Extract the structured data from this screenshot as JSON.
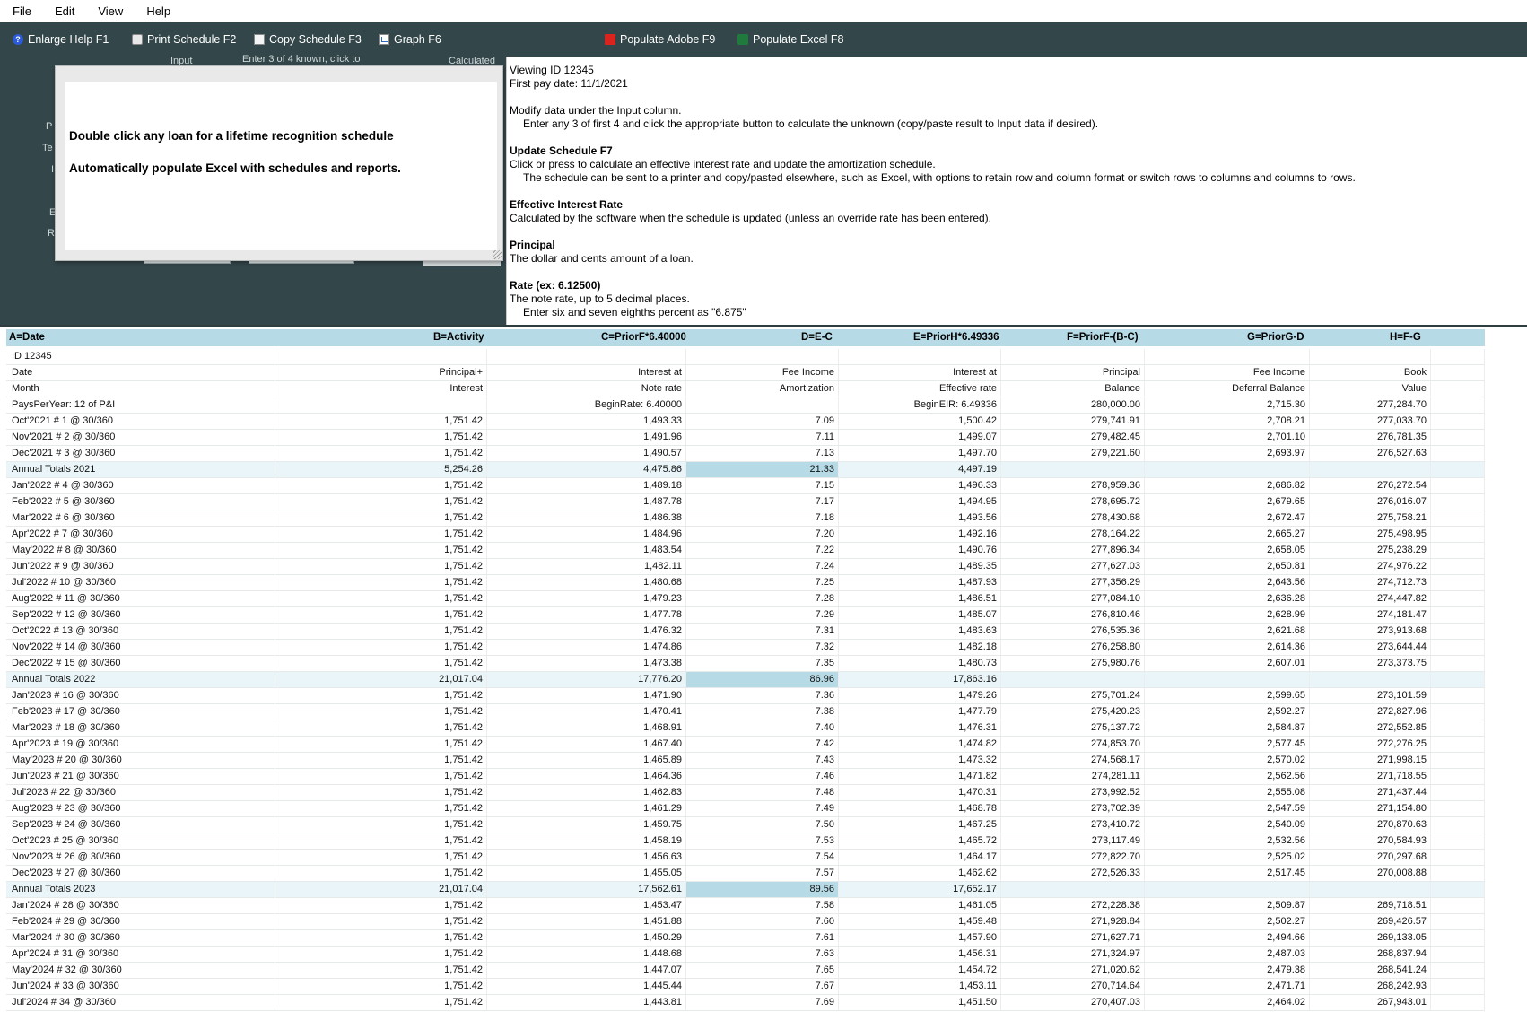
{
  "menu": [
    "File",
    "Edit",
    "View",
    "Help"
  ],
  "toolbar": {
    "enlarge_help": "Enlarge Help  F1",
    "print_schedule": "Print Schedule  F2",
    "copy_schedule": "Copy Schedule  F3",
    "graph": "Graph  F6",
    "populate_adobe": "Populate Adobe  F9",
    "populate_excel": "Populate Excel  F8"
  },
  "left_panel": {
    "ghost_top": [
      "Input",
      "Enter 3 of 4 known, click to",
      "Calculated"
    ],
    "ghost_labels": [
      "P",
      "Te",
      "I",
      "E",
      "R"
    ]
  },
  "popup": {
    "line1": "Double click any loan for a lifetime recognition schedule",
    "line2": "Automatically populate Excel with schedules and reports."
  },
  "help": {
    "viewing": "Viewing ID 12345",
    "first_pay": "First pay date: 11/1/2021",
    "modify": "Modify data under the Input column.",
    "modify_sub": "Enter any 3 of first 4 and click the appropriate button to calculate the unknown (copy/paste result to Input data if desired).",
    "update_title": "Update Schedule  F7",
    "update_body": "Click or press to calculate an effective interest rate and update the amortization schedule.",
    "update_sub": "The schedule can be sent to a printer and copy/pasted elsewhere, such as Excel, with options to retain row and column format or switch rows to columns and columns to rows.",
    "eir_title": "Effective Interest Rate",
    "eir_body": "Calculated by the software when the schedule is updated (unless an override rate has been entered).",
    "principal_title": "Principal",
    "principal_body": "The dollar and cents amount of a loan.",
    "rate_title": "Rate (ex: 6.12500)",
    "rate_body": "The note rate, up to 5 decimal places.",
    "rate_sub": "Enter six and seven eighths percent as \"6.875\""
  },
  "grid": {
    "columns": [
      "A=Date",
      "B=Activity",
      "C=PriorF*6.40000",
      "D=E-C",
      "E=PriorH*6.49336",
      "F=PriorF-(B-C)",
      "G=PriorG-D",
      "H=F-G"
    ],
    "rows": [
      {
        "c": [
          "ID 12345",
          "",
          "",
          "",
          "",
          "",
          "",
          ""
        ]
      },
      {
        "c": [
          "Date",
          "Principal+",
          "Interest at",
          "Fee Income",
          "Interest at",
          "Principal",
          "Fee Income",
          "Book"
        ]
      },
      {
        "c": [
          "Month",
          "Interest",
          "Note rate",
          "Amortization",
          "Effective rate",
          "Balance",
          "Deferral Balance",
          "Value"
        ]
      },
      {
        "c": [
          "PaysPerYear: 12 of P&I",
          "",
          "BeginRate: 6.40000",
          "",
          "BeginEIR: 6.49336",
          "280,000.00",
          "2,715.30",
          "277,284.70"
        ]
      },
      {
        "c": [
          "Oct'2021  # 1 @ 30/360",
          "1,751.42",
          "1,493.33",
          "7.09",
          "1,500.42",
          "279,741.91",
          "2,708.21",
          "277,033.70"
        ]
      },
      {
        "c": [
          "Nov'2021  # 2 @ 30/360",
          "1,751.42",
          "1,491.96",
          "7.11",
          "1,499.07",
          "279,482.45",
          "2,701.10",
          "276,781.35"
        ]
      },
      {
        "c": [
          "Dec'2021  # 3 @ 30/360",
          "1,751.42",
          "1,490.57",
          "7.13",
          "1,497.70",
          "279,221.60",
          "2,693.97",
          "276,527.63"
        ]
      },
      {
        "c": [
          "Annual Totals 2021",
          "5,254.26",
          "4,475.86",
          "21.33",
          "4,497.19",
          "",
          "",
          ""
        ],
        "total": true
      },
      {
        "c": [
          "Jan'2022  # 4 @ 30/360",
          "1,751.42",
          "1,489.18",
          "7.15",
          "1,496.33",
          "278,959.36",
          "2,686.82",
          "276,272.54"
        ]
      },
      {
        "c": [
          "Feb'2022  # 5 @ 30/360",
          "1,751.42",
          "1,487.78",
          "7.17",
          "1,494.95",
          "278,695.72",
          "2,679.65",
          "276,016.07"
        ]
      },
      {
        "c": [
          "Mar'2022  # 6 @ 30/360",
          "1,751.42",
          "1,486.38",
          "7.18",
          "1,493.56",
          "278,430.68",
          "2,672.47",
          "275,758.21"
        ]
      },
      {
        "c": [
          "Apr'2022  # 7 @ 30/360",
          "1,751.42",
          "1,484.96",
          "7.20",
          "1,492.16",
          "278,164.22",
          "2,665.27",
          "275,498.95"
        ]
      },
      {
        "c": [
          "May'2022  # 8 @ 30/360",
          "1,751.42",
          "1,483.54",
          "7.22",
          "1,490.76",
          "277,896.34",
          "2,658.05",
          "275,238.29"
        ]
      },
      {
        "c": [
          "Jun'2022  # 9 @ 30/360",
          "1,751.42",
          "1,482.11",
          "7.24",
          "1,489.35",
          "277,627.03",
          "2,650.81",
          "274,976.22"
        ]
      },
      {
        "c": [
          "Jul'2022  # 10 @ 30/360",
          "1,751.42",
          "1,480.68",
          "7.25",
          "1,487.93",
          "277,356.29",
          "2,643.56",
          "274,712.73"
        ]
      },
      {
        "c": [
          "Aug'2022  # 11 @ 30/360",
          "1,751.42",
          "1,479.23",
          "7.28",
          "1,486.51",
          "277,084.10",
          "2,636.28",
          "274,447.82"
        ]
      },
      {
        "c": [
          "Sep'2022  # 12 @ 30/360",
          "1,751.42",
          "1,477.78",
          "7.29",
          "1,485.07",
          "276,810.46",
          "2,628.99",
          "274,181.47"
        ]
      },
      {
        "c": [
          "Oct'2022  # 13 @ 30/360",
          "1,751.42",
          "1,476.32",
          "7.31",
          "1,483.63",
          "276,535.36",
          "2,621.68",
          "273,913.68"
        ]
      },
      {
        "c": [
          "Nov'2022  # 14 @ 30/360",
          "1,751.42",
          "1,474.86",
          "7.32",
          "1,482.18",
          "276,258.80",
          "2,614.36",
          "273,644.44"
        ]
      },
      {
        "c": [
          "Dec'2022  # 15 @ 30/360",
          "1,751.42",
          "1,473.38",
          "7.35",
          "1,480.73",
          "275,980.76",
          "2,607.01",
          "273,373.75"
        ]
      },
      {
        "c": [
          "Annual Totals 2022",
          "21,017.04",
          "17,776.20",
          "86.96",
          "17,863.16",
          "",
          "",
          ""
        ],
        "total": true
      },
      {
        "c": [
          "Jan'2023  # 16 @ 30/360",
          "1,751.42",
          "1,471.90",
          "7.36",
          "1,479.26",
          "275,701.24",
          "2,599.65",
          "273,101.59"
        ]
      },
      {
        "c": [
          "Feb'2023  # 17 @ 30/360",
          "1,751.42",
          "1,470.41",
          "7.38",
          "1,477.79",
          "275,420.23",
          "2,592.27",
          "272,827.96"
        ]
      },
      {
        "c": [
          "Mar'2023  # 18 @ 30/360",
          "1,751.42",
          "1,468.91",
          "7.40",
          "1,476.31",
          "275,137.72",
          "2,584.87",
          "272,552.85"
        ]
      },
      {
        "c": [
          "Apr'2023  # 19 @ 30/360",
          "1,751.42",
          "1,467.40",
          "7.42",
          "1,474.82",
          "274,853.70",
          "2,577.45",
          "272,276.25"
        ]
      },
      {
        "c": [
          "May'2023  # 20 @ 30/360",
          "1,751.42",
          "1,465.89",
          "7.43",
          "1,473.32",
          "274,568.17",
          "2,570.02",
          "271,998.15"
        ]
      },
      {
        "c": [
          "Jun'2023  # 21 @ 30/360",
          "1,751.42",
          "1,464.36",
          "7.46",
          "1,471.82",
          "274,281.11",
          "2,562.56",
          "271,718.55"
        ]
      },
      {
        "c": [
          "Jul'2023  # 22 @ 30/360",
          "1,751.42",
          "1,462.83",
          "7.48",
          "1,470.31",
          "273,992.52",
          "2,555.08",
          "271,437.44"
        ]
      },
      {
        "c": [
          "Aug'2023  # 23 @ 30/360",
          "1,751.42",
          "1,461.29",
          "7.49",
          "1,468.78",
          "273,702.39",
          "2,547.59",
          "271,154.80"
        ]
      },
      {
        "c": [
          "Sep'2023  # 24 @ 30/360",
          "1,751.42",
          "1,459.75",
          "7.50",
          "1,467.25",
          "273,410.72",
          "2,540.09",
          "270,870.63"
        ]
      },
      {
        "c": [
          "Oct'2023  # 25 @ 30/360",
          "1,751.42",
          "1,458.19",
          "7.53",
          "1,465.72",
          "273,117.49",
          "2,532.56",
          "270,584.93"
        ]
      },
      {
        "c": [
          "Nov'2023  # 26 @ 30/360",
          "1,751.42",
          "1,456.63",
          "7.54",
          "1,464.17",
          "272,822.70",
          "2,525.02",
          "270,297.68"
        ]
      },
      {
        "c": [
          "Dec'2023  # 27 @ 30/360",
          "1,751.42",
          "1,455.05",
          "7.57",
          "1,462.62",
          "272,526.33",
          "2,517.45",
          "270,008.88"
        ]
      },
      {
        "c": [
          "Annual Totals 2023",
          "21,017.04",
          "17,562.61",
          "89.56",
          "17,652.17",
          "",
          "",
          ""
        ],
        "total": true
      },
      {
        "c": [
          "Jan'2024  # 28 @ 30/360",
          "1,751.42",
          "1,453.47",
          "7.58",
          "1,461.05",
          "272,228.38",
          "2,509.87",
          "269,718.51"
        ]
      },
      {
        "c": [
          "Feb'2024  # 29 @ 30/360",
          "1,751.42",
          "1,451.88",
          "7.60",
          "1,459.48",
          "271,928.84",
          "2,502.27",
          "269,426.57"
        ]
      },
      {
        "c": [
          "Mar'2024  # 30 @ 30/360",
          "1,751.42",
          "1,450.29",
          "7.61",
          "1,457.90",
          "271,627.71",
          "2,494.66",
          "269,133.05"
        ]
      },
      {
        "c": [
          "Apr'2024  # 31 @ 30/360",
          "1,751.42",
          "1,448.68",
          "7.63",
          "1,456.31",
          "271,324.97",
          "2,487.03",
          "268,837.94"
        ]
      },
      {
        "c": [
          "May'2024  # 32 @ 30/360",
          "1,751.42",
          "1,447.07",
          "7.65",
          "1,454.72",
          "271,020.62",
          "2,479.38",
          "268,541.24"
        ]
      },
      {
        "c": [
          "Jun'2024  # 33 @ 30/360",
          "1,751.42",
          "1,445.44",
          "7.67",
          "1,453.11",
          "270,714.64",
          "2,471.71",
          "268,242.93"
        ]
      },
      {
        "c": [
          "Jul'2024  # 34 @ 30/360",
          "1,751.42",
          "1,443.81",
          "7.69",
          "1,451.50",
          "270,407.03",
          "2,464.02",
          "267,943.01"
        ]
      }
    ]
  }
}
